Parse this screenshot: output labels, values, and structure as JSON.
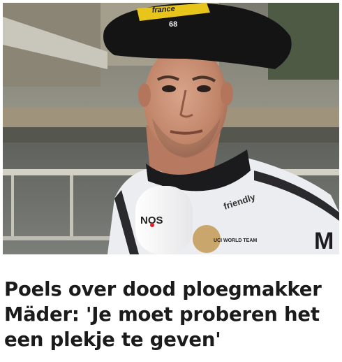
{
  "article": {
    "headline_lines": [
      "Poels over dood ploegmakker",
      "Mäder: 'Je moet proberen het",
      "een plekje te geven'"
    ]
  },
  "photo": {
    "beret_text": [
      "france",
      "68"
    ],
    "microphone_brand": "NOS",
    "jersey_text": [
      "friendly",
      "UCI WORLD TEAM",
      "M"
    ],
    "colors": {
      "beret": "#141414",
      "beret_patch": "#e8c51a",
      "river": "#6e716c",
      "railing": "#d3d0c6",
      "jersey": "#ecedf0",
      "nos_red": "#e0242e"
    }
  }
}
